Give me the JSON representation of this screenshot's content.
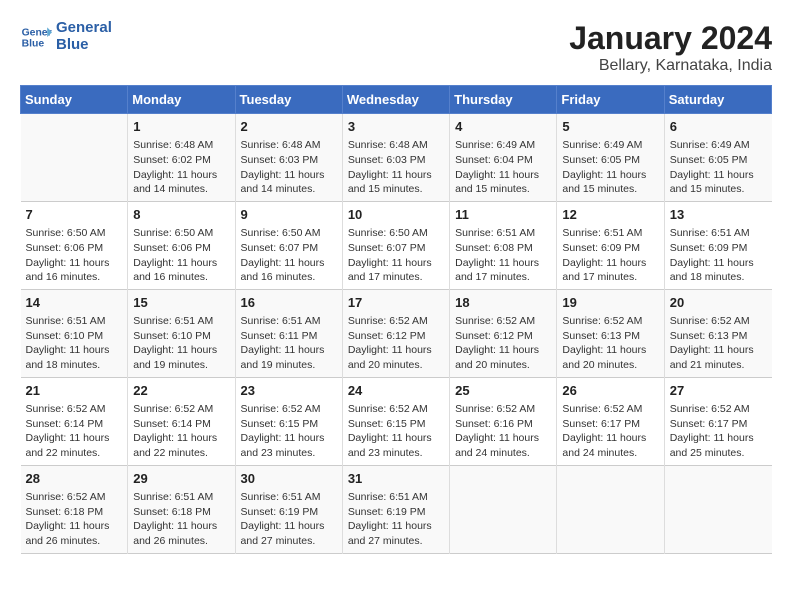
{
  "header": {
    "logo_line1": "General",
    "logo_line2": "Blue",
    "title": "January 2024",
    "subtitle": "Bellary, Karnataka, India"
  },
  "columns": [
    "Sunday",
    "Monday",
    "Tuesday",
    "Wednesday",
    "Thursday",
    "Friday",
    "Saturday"
  ],
  "weeks": [
    [
      {
        "day": "",
        "sunrise": "",
        "sunset": "",
        "daylight": ""
      },
      {
        "day": "1",
        "sunrise": "Sunrise: 6:48 AM",
        "sunset": "Sunset: 6:02 PM",
        "daylight": "Daylight: 11 hours and 14 minutes."
      },
      {
        "day": "2",
        "sunrise": "Sunrise: 6:48 AM",
        "sunset": "Sunset: 6:03 PM",
        "daylight": "Daylight: 11 hours and 14 minutes."
      },
      {
        "day": "3",
        "sunrise": "Sunrise: 6:48 AM",
        "sunset": "Sunset: 6:03 PM",
        "daylight": "Daylight: 11 hours and 15 minutes."
      },
      {
        "day": "4",
        "sunrise": "Sunrise: 6:49 AM",
        "sunset": "Sunset: 6:04 PM",
        "daylight": "Daylight: 11 hours and 15 minutes."
      },
      {
        "day": "5",
        "sunrise": "Sunrise: 6:49 AM",
        "sunset": "Sunset: 6:05 PM",
        "daylight": "Daylight: 11 hours and 15 minutes."
      },
      {
        "day": "6",
        "sunrise": "Sunrise: 6:49 AM",
        "sunset": "Sunset: 6:05 PM",
        "daylight": "Daylight: 11 hours and 15 minutes."
      }
    ],
    [
      {
        "day": "7",
        "sunrise": "Sunrise: 6:50 AM",
        "sunset": "Sunset: 6:06 PM",
        "daylight": "Daylight: 11 hours and 16 minutes."
      },
      {
        "day": "8",
        "sunrise": "Sunrise: 6:50 AM",
        "sunset": "Sunset: 6:06 PM",
        "daylight": "Daylight: 11 hours and 16 minutes."
      },
      {
        "day": "9",
        "sunrise": "Sunrise: 6:50 AM",
        "sunset": "Sunset: 6:07 PM",
        "daylight": "Daylight: 11 hours and 16 minutes."
      },
      {
        "day": "10",
        "sunrise": "Sunrise: 6:50 AM",
        "sunset": "Sunset: 6:07 PM",
        "daylight": "Daylight: 11 hours and 17 minutes."
      },
      {
        "day": "11",
        "sunrise": "Sunrise: 6:51 AM",
        "sunset": "Sunset: 6:08 PM",
        "daylight": "Daylight: 11 hours and 17 minutes."
      },
      {
        "day": "12",
        "sunrise": "Sunrise: 6:51 AM",
        "sunset": "Sunset: 6:09 PM",
        "daylight": "Daylight: 11 hours and 17 minutes."
      },
      {
        "day": "13",
        "sunrise": "Sunrise: 6:51 AM",
        "sunset": "Sunset: 6:09 PM",
        "daylight": "Daylight: 11 hours and 18 minutes."
      }
    ],
    [
      {
        "day": "14",
        "sunrise": "Sunrise: 6:51 AM",
        "sunset": "Sunset: 6:10 PM",
        "daylight": "Daylight: 11 hours and 18 minutes."
      },
      {
        "day": "15",
        "sunrise": "Sunrise: 6:51 AM",
        "sunset": "Sunset: 6:10 PM",
        "daylight": "Daylight: 11 hours and 19 minutes."
      },
      {
        "day": "16",
        "sunrise": "Sunrise: 6:51 AM",
        "sunset": "Sunset: 6:11 PM",
        "daylight": "Daylight: 11 hours and 19 minutes."
      },
      {
        "day": "17",
        "sunrise": "Sunrise: 6:52 AM",
        "sunset": "Sunset: 6:12 PM",
        "daylight": "Daylight: 11 hours and 20 minutes."
      },
      {
        "day": "18",
        "sunrise": "Sunrise: 6:52 AM",
        "sunset": "Sunset: 6:12 PM",
        "daylight": "Daylight: 11 hours and 20 minutes."
      },
      {
        "day": "19",
        "sunrise": "Sunrise: 6:52 AM",
        "sunset": "Sunset: 6:13 PM",
        "daylight": "Daylight: 11 hours and 20 minutes."
      },
      {
        "day": "20",
        "sunrise": "Sunrise: 6:52 AM",
        "sunset": "Sunset: 6:13 PM",
        "daylight": "Daylight: 11 hours and 21 minutes."
      }
    ],
    [
      {
        "day": "21",
        "sunrise": "Sunrise: 6:52 AM",
        "sunset": "Sunset: 6:14 PM",
        "daylight": "Daylight: 11 hours and 22 minutes."
      },
      {
        "day": "22",
        "sunrise": "Sunrise: 6:52 AM",
        "sunset": "Sunset: 6:14 PM",
        "daylight": "Daylight: 11 hours and 22 minutes."
      },
      {
        "day": "23",
        "sunrise": "Sunrise: 6:52 AM",
        "sunset": "Sunset: 6:15 PM",
        "daylight": "Daylight: 11 hours and 23 minutes."
      },
      {
        "day": "24",
        "sunrise": "Sunrise: 6:52 AM",
        "sunset": "Sunset: 6:15 PM",
        "daylight": "Daylight: 11 hours and 23 minutes."
      },
      {
        "day": "25",
        "sunrise": "Sunrise: 6:52 AM",
        "sunset": "Sunset: 6:16 PM",
        "daylight": "Daylight: 11 hours and 24 minutes."
      },
      {
        "day": "26",
        "sunrise": "Sunrise: 6:52 AM",
        "sunset": "Sunset: 6:17 PM",
        "daylight": "Daylight: 11 hours and 24 minutes."
      },
      {
        "day": "27",
        "sunrise": "Sunrise: 6:52 AM",
        "sunset": "Sunset: 6:17 PM",
        "daylight": "Daylight: 11 hours and 25 minutes."
      }
    ],
    [
      {
        "day": "28",
        "sunrise": "Sunrise: 6:52 AM",
        "sunset": "Sunset: 6:18 PM",
        "daylight": "Daylight: 11 hours and 26 minutes."
      },
      {
        "day": "29",
        "sunrise": "Sunrise: 6:51 AM",
        "sunset": "Sunset: 6:18 PM",
        "daylight": "Daylight: 11 hours and 26 minutes."
      },
      {
        "day": "30",
        "sunrise": "Sunrise: 6:51 AM",
        "sunset": "Sunset: 6:19 PM",
        "daylight": "Daylight: 11 hours and 27 minutes."
      },
      {
        "day": "31",
        "sunrise": "Sunrise: 6:51 AM",
        "sunset": "Sunset: 6:19 PM",
        "daylight": "Daylight: 11 hours and 27 minutes."
      },
      {
        "day": "",
        "sunrise": "",
        "sunset": "",
        "daylight": ""
      },
      {
        "day": "",
        "sunrise": "",
        "sunset": "",
        "daylight": ""
      },
      {
        "day": "",
        "sunrise": "",
        "sunset": "",
        "daylight": ""
      }
    ]
  ]
}
